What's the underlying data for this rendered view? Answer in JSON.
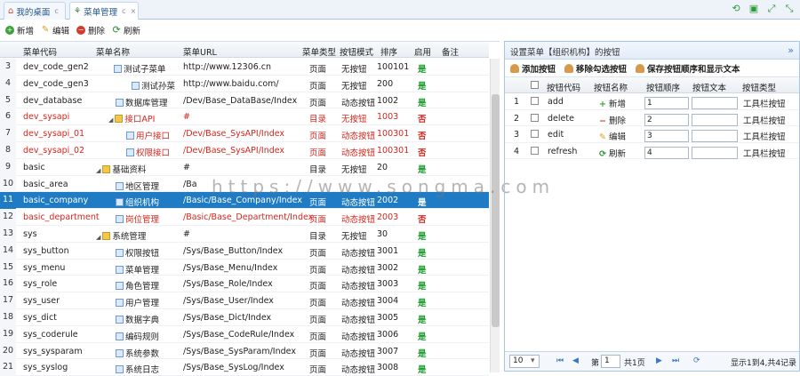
{
  "tabs": [
    {
      "label": "我的桌面",
      "icon": "home-icon"
    },
    {
      "label": "菜单管理",
      "icon": "tree-icon"
    }
  ],
  "toolbar": {
    "add": "新增",
    "edit": "编辑",
    "delete": "删除",
    "refresh": "刷新"
  },
  "grid": {
    "headers": {
      "code": "菜单代码",
      "name": "菜单名称",
      "url": "菜单URL",
      "type": "菜单类型",
      "btn_mode": "按钮模式",
      "order": "排序",
      "enabled": "启用",
      "remark": "备注"
    },
    "rows": [
      {
        "n": "3",
        "code": "dev_code_gen2",
        "name": "测试子菜单",
        "url": "http://www.12306.cn",
        "type": "页面",
        "mode": "无按钮",
        "order": "100101",
        "en": "是",
        "style": ""
      },
      {
        "n": "4",
        "code": "dev_code_gen3",
        "name": "测试孙菜",
        "url": "http://www.baidu.com/",
        "type": "页面",
        "mode": "无按钮",
        "order": "200",
        "en": "是",
        "style": ""
      },
      {
        "n": "5",
        "code": "dev_database",
        "name": "数据库管理",
        "url": "/Dev/Base_DataBase/Index",
        "type": "页面",
        "mode": "动态按钮",
        "order": "1002",
        "en": "是",
        "style": ""
      },
      {
        "n": "6",
        "code": "dev_sysapi",
        "name": "接口API",
        "url": "#",
        "type": "目录",
        "mode": "无按钮",
        "order": "1003",
        "en": "否",
        "style": "red"
      },
      {
        "n": "7",
        "code": "dev_sysapi_01",
        "name": "用户接口",
        "url": "/Dev/Base_SysAPI/Index",
        "type": "页面",
        "mode": "动态按钮",
        "order": "100301",
        "en": "否",
        "style": "red"
      },
      {
        "n": "8",
        "code": "dev_sysapi_02",
        "name": "权限接口",
        "url": "/Dev/Base_SysAPI/Index",
        "type": "页面",
        "mode": "动态按钮",
        "order": "100301",
        "en": "否",
        "style": "red"
      },
      {
        "n": "9",
        "code": "basic",
        "name": "基础资料",
        "url": "#",
        "type": "目录",
        "mode": "无按钮",
        "order": "20",
        "en": "是",
        "style": ""
      },
      {
        "n": "10",
        "code": "basic_area",
        "name": "地区管理",
        "url": "/Ba",
        "type": "",
        "mode": "",
        "order": "",
        "en": "",
        "style": ""
      },
      {
        "n": "11",
        "code": "basic_company",
        "name": "组织机构",
        "url": "/Basic/Base_Company/Index",
        "type": "页面",
        "mode": "动态按钮",
        "order": "2002",
        "en": "是",
        "style": "sel"
      },
      {
        "n": "12",
        "code": "basic_department",
        "name": "岗位管理",
        "url": "/Basic/Base_Department/Index",
        "type": "页面",
        "mode": "动态按钮",
        "order": "2003",
        "en": "否",
        "style": "red"
      },
      {
        "n": "13",
        "code": "sys",
        "name": "系统管理",
        "url": "#",
        "type": "目录",
        "mode": "无按钮",
        "order": "30",
        "en": "是",
        "style": ""
      },
      {
        "n": "14",
        "code": "sys_button",
        "name": "权限按钮",
        "url": "/Sys/Base_Button/Index",
        "type": "页面",
        "mode": "动态按钮",
        "order": "3001",
        "en": "是",
        "style": ""
      },
      {
        "n": "15",
        "code": "sys_menu",
        "name": "菜单管理",
        "url": "/Sys/Base_Menu/Index",
        "type": "页面",
        "mode": "动态按钮",
        "order": "3002",
        "en": "是",
        "style": ""
      },
      {
        "n": "16",
        "code": "sys_role",
        "name": "角色管理",
        "url": "/Sys/Base_Role/Index",
        "type": "页面",
        "mode": "动态按钮",
        "order": "3003",
        "en": "是",
        "style": ""
      },
      {
        "n": "17",
        "code": "sys_user",
        "name": "用户管理",
        "url": "/Sys/Base_User/Index",
        "type": "页面",
        "mode": "动态按钮",
        "order": "3004",
        "en": "是",
        "style": ""
      },
      {
        "n": "18",
        "code": "sys_dict",
        "name": "数据字典",
        "url": "/Sys/Base_Dict/Index",
        "type": "页面",
        "mode": "动态按钮",
        "order": "3005",
        "en": "是",
        "style": ""
      },
      {
        "n": "19",
        "code": "sys_coderule",
        "name": "编码规则",
        "url": "/Sys/Base_CodeRule/Index",
        "type": "页面",
        "mode": "动态按钮",
        "order": "3006",
        "en": "是",
        "style": ""
      },
      {
        "n": "20",
        "code": "sys_sysparam",
        "name": "系统参数",
        "url": "/Sys/Base_SysParam/Index",
        "type": "页面",
        "mode": "动态按钮",
        "order": "3007",
        "en": "是",
        "style": ""
      },
      {
        "n": "21",
        "code": "sys_syslog",
        "name": "系统日志",
        "url": "/Sys/Base_SysLog/Index",
        "type": "页面",
        "mode": "动态按钮",
        "order": "3008",
        "en": "是",
        "style": ""
      }
    ]
  },
  "watermark": "https://www.songma.com",
  "panel": {
    "title": "设置菜单【组织机构】的按钮",
    "toolbar": {
      "add": "添加按钮",
      "remove": "移除勾选按钮",
      "save": "保存按钮顺序和显示文本"
    },
    "headers": {
      "code": "按钮代码",
      "name": "按钮名称",
      "order": "按钮顺序",
      "text": "按钮文本",
      "type": "按钮类型"
    },
    "rows": [
      {
        "n": "1",
        "code": "add",
        "name": "新增",
        "order": "1",
        "text": "",
        "type": "工具栏按钮",
        "icon": "add-icon"
      },
      {
        "n": "2",
        "code": "delete",
        "name": "删除",
        "order": "2",
        "text": "",
        "type": "工具栏按钮",
        "icon": "delete-icon"
      },
      {
        "n": "3",
        "code": "edit",
        "name": "编辑",
        "order": "3",
        "text": "",
        "type": "工具栏按钮",
        "icon": "edit-icon"
      },
      {
        "n": "4",
        "code": "refresh",
        "name": "刷新",
        "order": "4",
        "text": "",
        "type": "工具栏按钮",
        "icon": "refresh-icon"
      }
    ],
    "pager": {
      "page_size": "10",
      "page_label_pre": "第",
      "page": "1",
      "page_label_post": "共1页",
      "summary": "显示1到4,共4记录"
    }
  }
}
